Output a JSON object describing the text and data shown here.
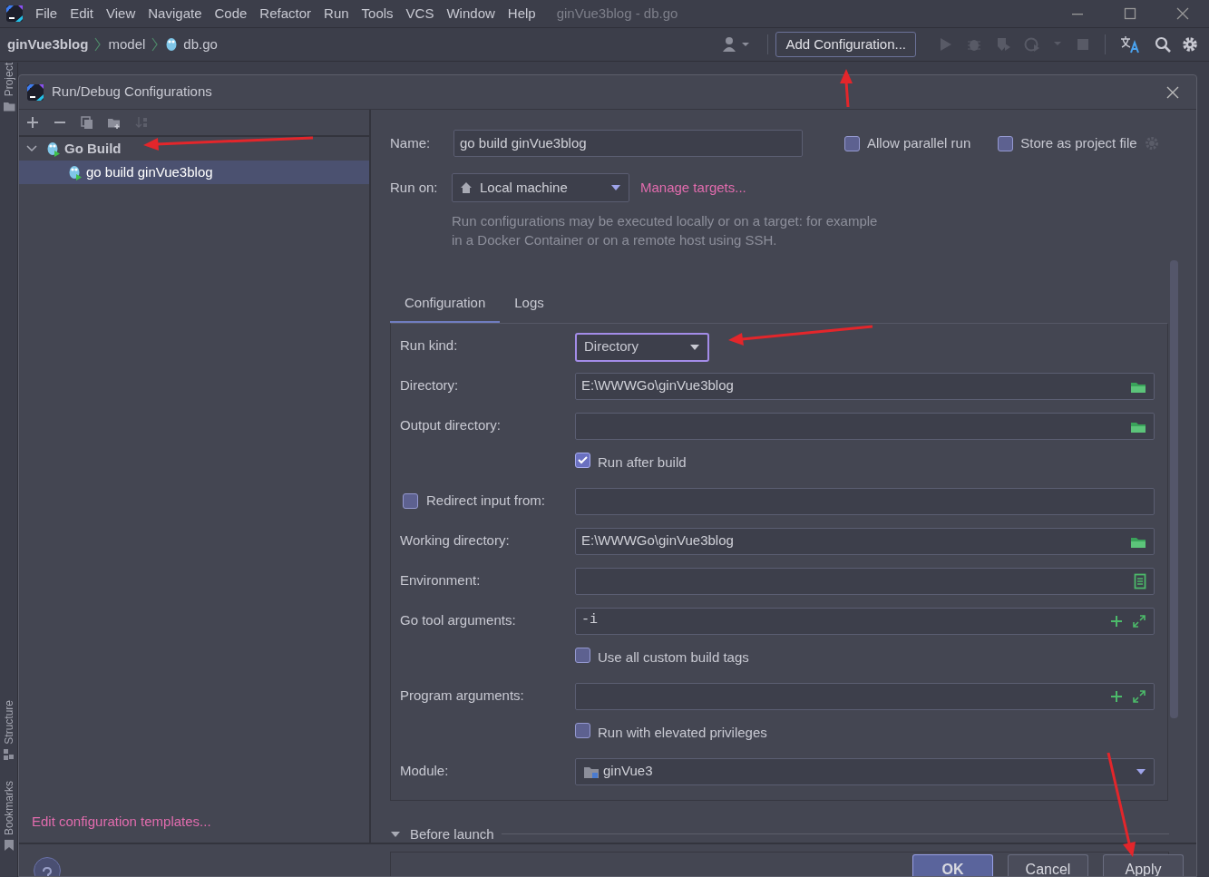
{
  "menu": {
    "items": [
      "File",
      "Edit",
      "View",
      "Navigate",
      "Code",
      "Refactor",
      "Run",
      "Tools",
      "VCS",
      "Window",
      "Help"
    ]
  },
  "window": {
    "title": "ginVue3blog - db.go"
  },
  "breadcrumbs": [
    "ginVue3blog",
    "model",
    "db.go"
  ],
  "toolbar": {
    "config_button": "Add Configuration..."
  },
  "tool_windows": [
    "Project",
    "Structure",
    "Bookmarks"
  ],
  "dialog": {
    "title": "Run/Debug Configurations",
    "tree": [
      {
        "label": "Go Build",
        "expanded": true,
        "selected": false,
        "children": [
          {
            "label": "go build ginVue3blog",
            "selected": true
          }
        ]
      }
    ],
    "templates_link": "Edit configuration templates...",
    "name": {
      "label": "Name:",
      "value": "go build ginVue3blog"
    },
    "options": [
      {
        "label": "Allow parallel run",
        "checked": false
      },
      {
        "label": "Store as project file",
        "checked": false
      }
    ],
    "run_on": {
      "label": "Run on:",
      "value": "Local machine",
      "link": "Manage targets...",
      "hint": "Run configurations may be executed locally or on a target: for example in a Docker Container or on a remote host using SSH."
    },
    "tabs": [
      {
        "label": "Configuration",
        "selected": true
      },
      {
        "label": "Logs",
        "selected": false
      }
    ],
    "fields": [
      {
        "kind": "select",
        "label": "Run kind:",
        "value": "Directory"
      },
      {
        "kind": "path",
        "label": "Directory:",
        "value": "E:\\WWWGo\\ginVue3blog"
      },
      {
        "kind": "path",
        "label": "Output directory:"
      },
      {
        "kind": "check",
        "label": "Run after build",
        "checked": true
      },
      {
        "kind": "checkpath",
        "label": "Redirect input from:",
        "checked": false
      },
      {
        "kind": "path",
        "label": "Working directory:",
        "value": "E:\\WWWGo\\ginVue3blog"
      },
      {
        "kind": "env",
        "label": "Environment:"
      },
      {
        "kind": "args",
        "label": "Go tool arguments:",
        "value": "-i"
      },
      {
        "kind": "check",
        "label": "Use all custom build tags",
        "checked": false
      },
      {
        "kind": "args",
        "label": "Program arguments:"
      },
      {
        "kind": "check",
        "label": "Run with elevated privileges",
        "checked": false
      },
      {
        "kind": "module",
        "label": "Module:",
        "value": "ginVue3"
      }
    ],
    "before_launch": {
      "label": "Before launch",
      "expanded": true
    },
    "buttons": [
      {
        "label": "OK",
        "primary": true
      },
      {
        "label": "Cancel",
        "primary": false
      },
      {
        "label": "Apply",
        "primary": false
      }
    ]
  }
}
